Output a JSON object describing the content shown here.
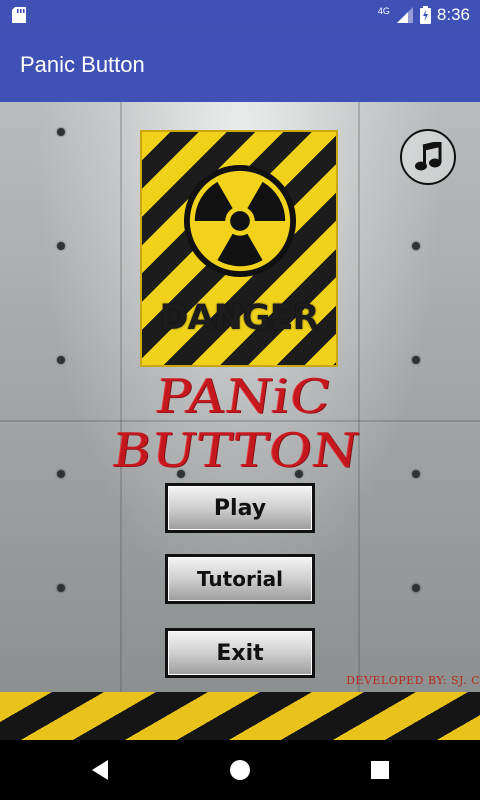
{
  "status_bar": {
    "network": "4G",
    "time": "8:36"
  },
  "app_bar": {
    "title": "Panic Button"
  },
  "sign": {
    "text": "DANGER"
  },
  "title_graffiti": "PANiC BUTTON",
  "menu": {
    "play": "Play",
    "tutorial": "Tutorial",
    "exit": "Exit"
  },
  "credit": "DEVELOPED BY: SJ. C",
  "colors": {
    "primary": "#3f51b5",
    "hazard_yellow": "#f0d21a",
    "graffiti_red": "#c4171e"
  },
  "icons": [
    "sd-card-icon",
    "signal-icon",
    "battery-icon",
    "music-note-icon",
    "radiation-icon",
    "back-icon",
    "home-icon",
    "recents-icon"
  ]
}
